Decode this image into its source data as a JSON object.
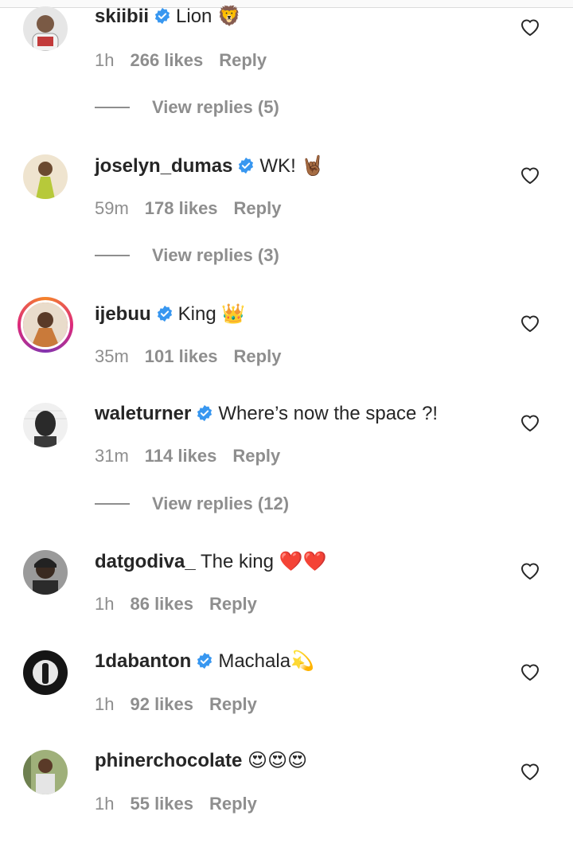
{
  "comments": [
    {
      "username": "skiibii",
      "verified": true,
      "text": "Lion 🦁",
      "time": "1h",
      "likes": "266 likes",
      "reply": "Reply",
      "view_replies": "View replies (5)",
      "avatar_color": "#6b6b6b"
    },
    {
      "username": "joselyn_dumas",
      "verified": true,
      "text": "WK! 🤘🏾",
      "time": "59m",
      "likes": "178 likes",
      "reply": "Reply",
      "view_replies": "View replies (3)",
      "avatar_color": "#c9a46a"
    },
    {
      "username": "ijebuu",
      "verified": true,
      "text": "King 👑",
      "time": "35m",
      "likes": "101 likes",
      "reply": "Reply",
      "view_replies": null,
      "avatar_color": "#d8c7b0"
    },
    {
      "username": "waleturner",
      "verified": true,
      "text": "Where’s now the space ?!",
      "time": "31m",
      "likes": "114 likes",
      "reply": "Reply",
      "view_replies": "View replies (12)",
      "avatar_color": "#3b3b3b"
    },
    {
      "username": "datgodiva_",
      "verified": false,
      "text": "The king ❤️❤️",
      "time": "1h",
      "likes": "86 likes",
      "reply": "Reply",
      "view_replies": null,
      "avatar_color": "#4a4a4a"
    },
    {
      "username": "1dabanton",
      "verified": true,
      "text": "Machala💫",
      "time": "1h",
      "likes": "92 likes",
      "reply": "Reply",
      "view_replies": null,
      "avatar_color": "#1e1e1e"
    },
    {
      "username": "phinerchocolate",
      "verified": false,
      "text": "😍😍😍",
      "time": "1h",
      "likes": "55 likes",
      "reply": "Reply",
      "view_replies": null,
      "avatar_color": "#6f7d5a"
    }
  ],
  "colors": {
    "verified_blue": "#3897f0",
    "meta_gray": "#8e8e8e",
    "text": "#262626"
  }
}
